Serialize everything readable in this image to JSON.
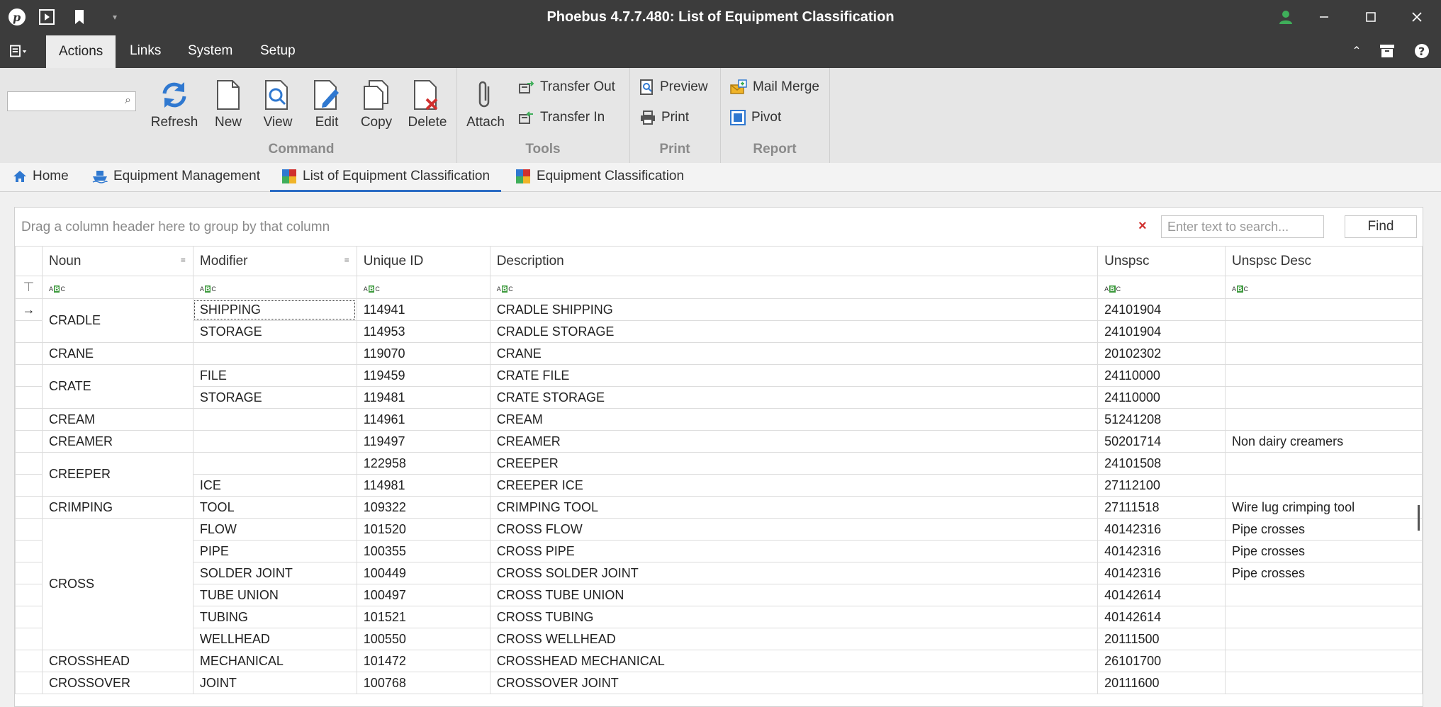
{
  "window": {
    "title": "Phoebus 4.7.7.480: List of Equipment Classification"
  },
  "menu": {
    "items": [
      "Actions",
      "Links",
      "System",
      "Setup"
    ]
  },
  "ribbon": {
    "search_placeholder": "",
    "command": {
      "label": "Command",
      "buttons": [
        "Refresh",
        "New",
        "View",
        "Edit",
        "Copy",
        "Delete"
      ]
    },
    "tools": {
      "label": "Tools",
      "attach": "Attach",
      "transfer_out": "Transfer Out",
      "transfer_in": "Transfer In"
    },
    "print": {
      "label": "Print",
      "preview": "Preview",
      "print": "Print"
    },
    "report": {
      "label": "Report",
      "mail_merge": "Mail Merge",
      "pivot": "Pivot"
    }
  },
  "tabs": [
    "Home",
    "Equipment Management",
    "List of Equipment Classification",
    "Equipment Classification"
  ],
  "grid": {
    "group_hint": "Drag a column header here to group by that column",
    "search_placeholder": "Enter text to search...",
    "find_label": "Find",
    "columns": [
      "Noun",
      "Modifier",
      "Unique ID",
      "Description",
      "Unspsc",
      "Unspsc Desc"
    ],
    "rows": [
      [
        "CRADLE",
        "SHIPPING",
        "114941",
        "CRADLE SHIPPING",
        "24101904",
        ""
      ],
      [
        "",
        "STORAGE",
        "114953",
        "CRADLE STORAGE",
        "24101904",
        ""
      ],
      [
        "CRANE",
        "",
        "119070",
        "CRANE",
        "20102302",
        ""
      ],
      [
        "CRATE",
        "FILE",
        "119459",
        "CRATE FILE",
        "24110000",
        ""
      ],
      [
        "",
        "STORAGE",
        "119481",
        "CRATE STORAGE",
        "24110000",
        ""
      ],
      [
        "CREAM",
        "",
        "114961",
        "CREAM",
        "51241208",
        ""
      ],
      [
        "CREAMER",
        "",
        "119497",
        "CREAMER",
        "50201714",
        "Non dairy creamers"
      ],
      [
        "CREEPER",
        "",
        "122958",
        "CREEPER",
        "24101508",
        ""
      ],
      [
        "",
        "ICE",
        "114981",
        "CREEPER ICE",
        "27112100",
        ""
      ],
      [
        "CRIMPING",
        "TOOL",
        "109322",
        "CRIMPING TOOL",
        "27111518",
        "Wire lug crimping tool"
      ],
      [
        "CROSS",
        "FLOW",
        "101520",
        "CROSS FLOW",
        "40142316",
        "Pipe crosses"
      ],
      [
        "",
        "PIPE",
        "100355",
        "CROSS PIPE",
        "40142316",
        "Pipe crosses"
      ],
      [
        "",
        "SOLDER JOINT",
        "100449",
        "CROSS SOLDER JOINT",
        "40142316",
        "Pipe crosses"
      ],
      [
        "",
        "TUBE UNION",
        "100497",
        "CROSS TUBE UNION",
        "40142614",
        ""
      ],
      [
        "",
        "TUBING",
        "101521",
        "CROSS TUBING",
        "40142614",
        ""
      ],
      [
        "",
        "WELLHEAD",
        "100550",
        "CROSS WELLHEAD",
        "20111500",
        ""
      ],
      [
        "CROSSHEAD",
        "MECHANICAL",
        "101472",
        "CROSSHEAD MECHANICAL",
        "26101700",
        ""
      ],
      [
        "CROSSOVER",
        "JOINT",
        "100768",
        "CROSSOVER JOINT",
        "20111600",
        ""
      ]
    ]
  }
}
